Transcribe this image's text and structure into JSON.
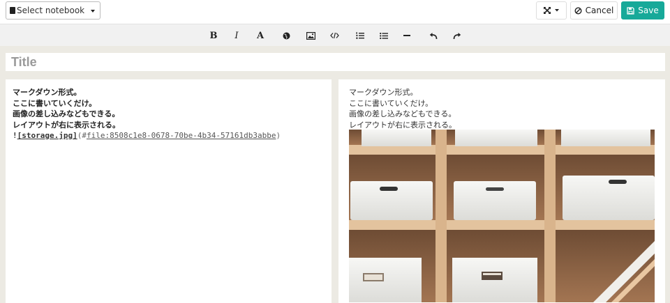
{
  "topbar": {
    "notebook_select": "Select notebook",
    "expand_icon": "expand-arrows-icon",
    "cancel_label": "Cancel",
    "save_label": "Save"
  },
  "toolbar": {
    "items": [
      "bold-icon",
      "italic-icon",
      "font-icon",
      "link-globe-icon",
      "image-icon",
      "code-icon",
      "ordered-list-icon",
      "unordered-list-icon",
      "horizontal-rule-icon",
      "undo-icon",
      "redo-icon"
    ]
  },
  "note": {
    "title_placeholder": "Title"
  },
  "editor": {
    "lines": [
      "マークダウン形式。",
      "ここに書いていくだけ。",
      "画像の差し込みなどもできる。",
      "レイアウトが右に表示される。"
    ],
    "image_markdown": {
      "bang": "!",
      "alt": "[storage.jpg]",
      "open": "(#",
      "link": "file:8508c1e8-0678-70be-4b34-57161db3abbe",
      "close": ")"
    }
  },
  "preview": {
    "lines": [
      "マークダウン形式。",
      "ここに書いていくだけ。",
      "画像の差し込みなどもできる。",
      "レイアウトが右に表示される。"
    ],
    "image_alt": "storage.jpg"
  },
  "colors": {
    "accent": "#17a999",
    "toolbar_bg": "#f1f1f1",
    "workspace_bg": "#eceae3"
  }
}
